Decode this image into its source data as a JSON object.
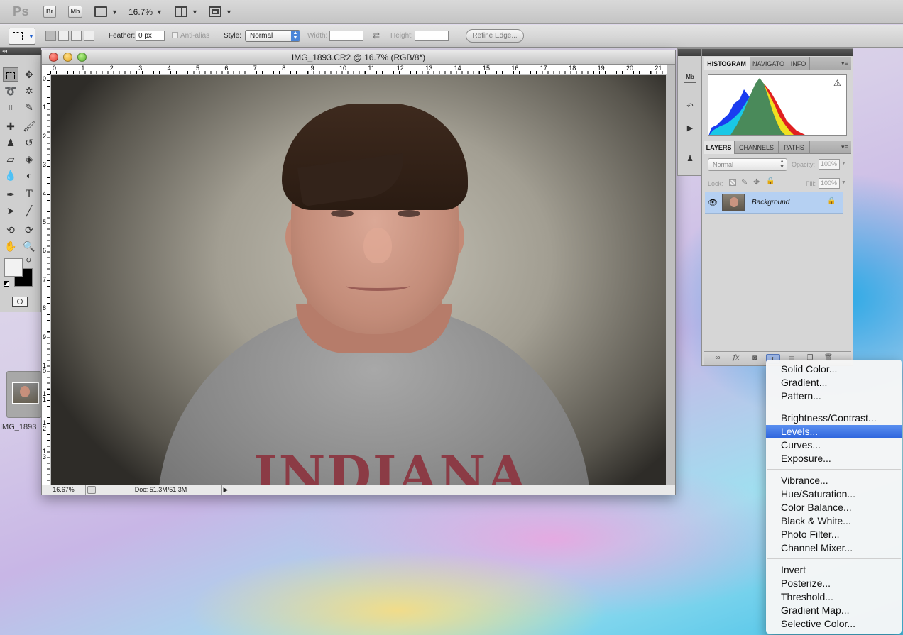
{
  "app": {
    "logo": "Ps",
    "bridge_label": "Br",
    "minibridge_label": "Mb",
    "zoom_value": "16.7%"
  },
  "options": {
    "feather_label": "Feather:",
    "feather_value": "0 px",
    "antialias_label": "Anti-alias",
    "style_label": "Style:",
    "style_value": "Normal",
    "width_label": "Width:",
    "height_label": "Height:",
    "refine_label": "Refine Edge..."
  },
  "document": {
    "title": "IMG_1893.CR2 @ 16.7% (RGB/8*)",
    "ruler_h": [
      "0",
      "1",
      "2",
      "3",
      "4",
      "5",
      "6",
      "7",
      "8",
      "9",
      "10",
      "11",
      "12",
      "13",
      "14",
      "15",
      "16",
      "17",
      "18",
      "19",
      "20",
      "21"
    ],
    "ruler_v": [
      "0",
      "1",
      "2",
      "3",
      "4",
      "5",
      "6",
      "7",
      "8",
      "9",
      "10",
      "11",
      "12",
      "13"
    ],
    "shirt_text": "INDIANA",
    "status_zoom": "16.67%",
    "status_doc": "Doc: 51.3M/51.3M"
  },
  "minimized_doc": {
    "label": "IMG_1893"
  },
  "histogram_panel": {
    "tabs": [
      "HISTOGRAM",
      "NAVIGATO",
      "INFO"
    ],
    "warning_icon": "warning-icon"
  },
  "layers_panel": {
    "tabs": [
      "LAYERS",
      "CHANNELS",
      "PATHS"
    ],
    "blend_mode": "Normal",
    "opacity_label": "Opacity:",
    "opacity_value": "100%",
    "lock_label": "Lock:",
    "fill_label": "Fill:",
    "fill_value": "100%",
    "layers": [
      {
        "name": "Background"
      }
    ]
  },
  "adjustment_menu": {
    "groups": [
      [
        "Solid Color...",
        "Gradient...",
        "Pattern..."
      ],
      [
        "Brightness/Contrast...",
        "Levels...",
        "Curves...",
        "Exposure..."
      ],
      [
        "Vibrance...",
        "Hue/Saturation...",
        "Color Balance...",
        "Black & White...",
        "Photo Filter...",
        "Channel Mixer..."
      ],
      [
        "Invert",
        "Posterize...",
        "Threshold...",
        "Gradient Map...",
        "Selective Color..."
      ]
    ],
    "highlighted": "Levels..."
  },
  "colors": {
    "menu_highlight": "#2d64dd",
    "layer_selected": "#b5d0f2",
    "histogram_blue": "#1a3cf0",
    "histogram_cyan": "#19c8e6",
    "histogram_green": "#4a8a5a",
    "histogram_yellow": "#f0e020",
    "histogram_red": "#e02020"
  }
}
